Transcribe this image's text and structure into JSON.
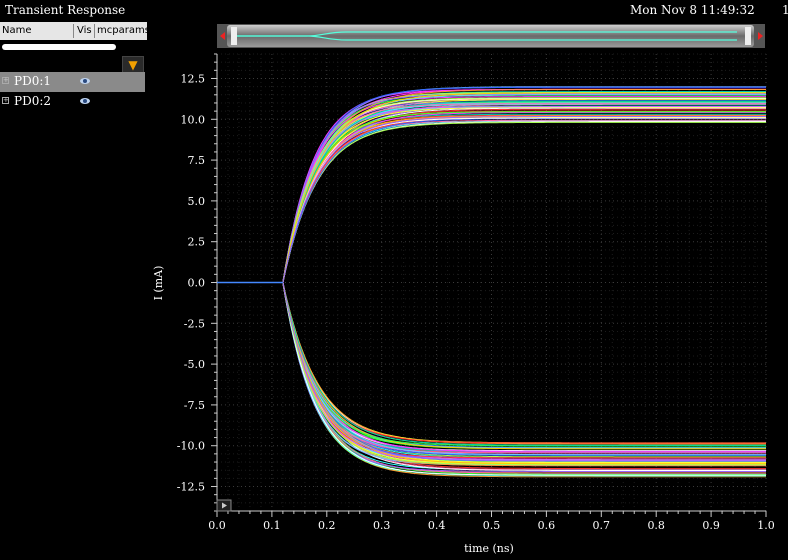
{
  "window": {
    "title": "Transient Response",
    "datetime": "Mon Nov 8 11:49:32",
    "trailing": "1"
  },
  "sidebar": {
    "columns": [
      "Name",
      "Vis",
      "mcparamse"
    ],
    "items": [
      {
        "label": "PD0:1",
        "selected": true
      },
      {
        "label": "PD0:2",
        "selected": false
      }
    ]
  },
  "chart_data": {
    "type": "line",
    "title": "",
    "xlabel": "time (ns)",
    "ylabel": "I (mA)",
    "xlim": [
      0.0,
      1.0
    ],
    "ylim": [
      -14.0,
      14.0
    ],
    "x_ticks": [
      "0.0",
      "0.1",
      "0.2",
      "0.3",
      "0.4",
      "0.5",
      "0.6",
      "0.7",
      "0.8",
      "0.9",
      "1.0"
    ],
    "y_ticks": [
      "12.5",
      "10.0",
      "7.5",
      "5.0",
      "2.5",
      "0.0",
      "-2.5",
      "-5.0",
      "-7.5",
      "-10.0",
      "-12.5"
    ],
    "grid": true,
    "series_groups": [
      {
        "name": "PD0:1",
        "start_time": 0.12,
        "rise_time_constant": 0.06,
        "final_values_mA": [
          9.8,
          12.0
        ]
      },
      {
        "name": "PD0:2",
        "start_time": 0.12,
        "rise_time_constant": 0.06,
        "final_values_mA": [
          -9.8,
          -12.0
        ]
      }
    ],
    "colors": [
      "#ff33ff",
      "#33ffff",
      "#ffff33",
      "#ff3333",
      "#33ff33",
      "#3366ff",
      "#ff9933",
      "#cc66ff",
      "#00ccaa",
      "#ffffff",
      "#ff66aa",
      "#66ccff",
      "#aaff55",
      "#ffcc00",
      "#9966ff"
    ]
  }
}
